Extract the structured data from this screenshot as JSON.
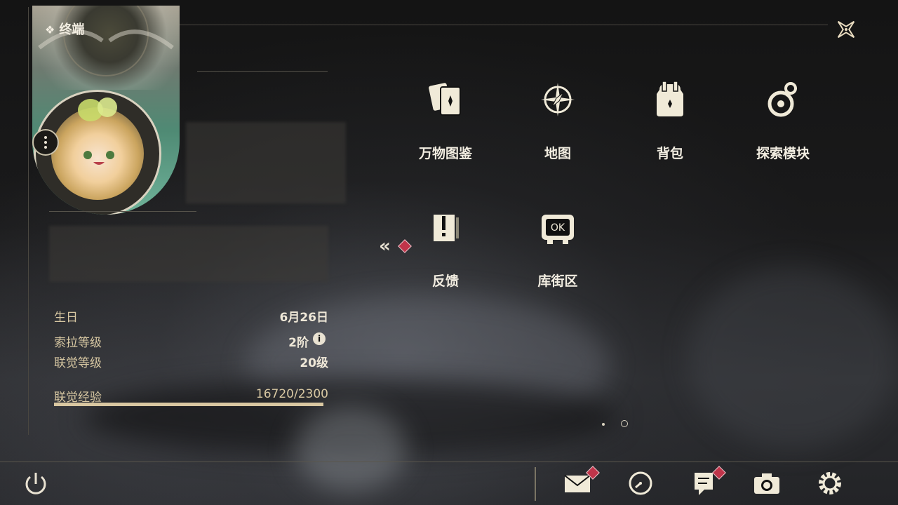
{
  "header": {
    "terminal_label": "终端"
  },
  "stats": {
    "birthday_label": "生日",
    "birthday_value": "6月26日",
    "sora_level_label": "索拉等级",
    "sora_level_value": "2阶",
    "link_level_label": "联觉等级",
    "link_level_value": "20级",
    "link_exp_label": "联觉经验",
    "link_exp_value": "16720/2300",
    "link_exp_fill": 1.0
  },
  "menu": {
    "tiles": [
      {
        "label": "万物图鉴",
        "icon": "card-collection-icon"
      },
      {
        "label": "地图",
        "icon": "compass-icon"
      },
      {
        "label": "背包",
        "icon": "backpack-icon"
      },
      {
        "label": "探索模块",
        "icon": "exploration-module-icon"
      },
      {
        "label": "反馈",
        "icon": "feedback-icon"
      },
      {
        "label": "库街区",
        "icon": "kuro-community-icon"
      }
    ]
  },
  "bottom": {
    "icons": [
      "power-icon",
      "mail-icon",
      "clock-icon",
      "notice-icon",
      "camera-icon",
      "settings-icon"
    ]
  },
  "colors": {
    "accent": "#d9c7a1",
    "badge": "#c0344a"
  }
}
